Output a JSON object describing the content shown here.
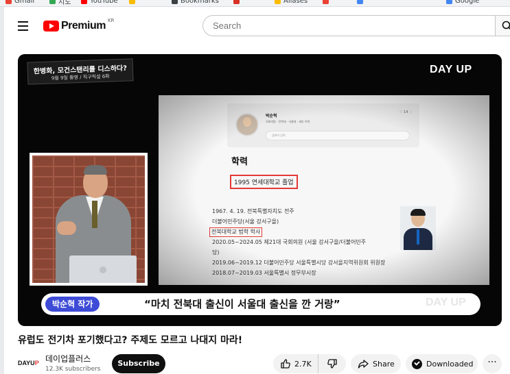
{
  "bookmarks": [
    {
      "label": "Gmail",
      "color": "#ea4335"
    },
    {
      "label": "지도",
      "color": "#34a853"
    },
    {
      "label": "YouTube",
      "color": "#ff0000"
    },
    {
      "label": "",
      "color": "#fbbc04"
    },
    {
      "label": "Bookmarks",
      "color": "#3c4043"
    },
    {
      "label": "",
      "color": "#d93025"
    },
    {
      "label": "Aliases",
      "color": "#fbbc04"
    },
    {
      "label": "",
      "color": "#ea4335"
    },
    {
      "label": "",
      "color": "#4285f4"
    },
    {
      "label": "Google",
      "color": "#4285f4"
    }
  ],
  "header": {
    "logo_text": "Premium",
    "logo_country": "KR",
    "search_placeholder": "Search"
  },
  "video": {
    "title_card_line1": "한병화, 모건스탠리를 디스하다?",
    "title_card_line2": "9월 9일 촬영 / 직구직설 6화",
    "brand": "DAY UP",
    "slide": {
      "profile_name": "박순혁",
      "profile_sub": "국회의원 · 전북대 · 서울대 · 세부 이력",
      "profile_input": "검색어 입력",
      "profile_icons": "♡ 14  ⋮",
      "education_heading": "학력",
      "education_item": "1995 연세대학교 졸업",
      "career": [
        "1967. 4. 19. 전북특별자치도 전주",
        "더불어민주당(서울 강서구을)",
        "전북대학교 법학 학사",
        "2020.05~2024.05 제21대 국회의원 (서울 강서구을/더불어민주",
        "당)",
        "2019.06~2019.12 더불어민주당 서울특별시당 강서을지역위원회 위원장",
        "2018.07~2019.03 서울특별시 정무부시장"
      ]
    },
    "caption_name": "박순혁 작가",
    "caption_text": "“마치 전북대 출신이 서울대 출신을 깐 거랑”",
    "caption_watermark": "DAY UP"
  },
  "info": {
    "title": "유럽도 전기차 포기했다고? 주제도 모르고 나대지 마라!",
    "channel_logo_a": "DAYU",
    "channel_logo_b": "P",
    "channel_name": "데이업플러스",
    "subscribers": "12.3K subscribers",
    "subscribe_label": "Subscribe",
    "like_count": "2.7K",
    "share_label": "Share",
    "download_label": "Downloaded",
    "more_label": "···"
  }
}
